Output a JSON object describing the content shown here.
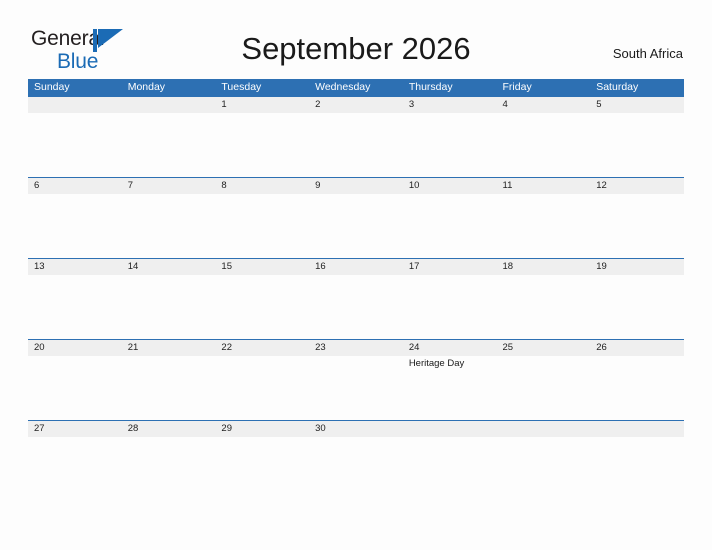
{
  "brand": {
    "name_part1": "General",
    "name_part2": "Blue",
    "flag_icon": "pennant-flag-icon",
    "accent_color": "#1b6bb5"
  },
  "header": {
    "title": "September 2026",
    "region": "South Africa"
  },
  "theme": {
    "header_blue": "#2d70b3",
    "band_gray": "#efefef",
    "page_background": "#fdfdfd",
    "text_dark": "#1a1a1a"
  },
  "calendar": {
    "month": "September",
    "year": "2026",
    "weekday_headers": [
      "Sunday",
      "Monday",
      "Tuesday",
      "Wednesday",
      "Thursday",
      "Friday",
      "Saturday"
    ],
    "weeks": [
      {
        "days": [
          {
            "num": "",
            "event": ""
          },
          {
            "num": "",
            "event": ""
          },
          {
            "num": "1",
            "event": ""
          },
          {
            "num": "2",
            "event": ""
          },
          {
            "num": "3",
            "event": ""
          },
          {
            "num": "4",
            "event": ""
          },
          {
            "num": "5",
            "event": ""
          }
        ]
      },
      {
        "days": [
          {
            "num": "6",
            "event": ""
          },
          {
            "num": "7",
            "event": ""
          },
          {
            "num": "8",
            "event": ""
          },
          {
            "num": "9",
            "event": ""
          },
          {
            "num": "10",
            "event": ""
          },
          {
            "num": "11",
            "event": ""
          },
          {
            "num": "12",
            "event": ""
          }
        ]
      },
      {
        "days": [
          {
            "num": "13",
            "event": ""
          },
          {
            "num": "14",
            "event": ""
          },
          {
            "num": "15",
            "event": ""
          },
          {
            "num": "16",
            "event": ""
          },
          {
            "num": "17",
            "event": ""
          },
          {
            "num": "18",
            "event": ""
          },
          {
            "num": "19",
            "event": ""
          }
        ]
      },
      {
        "days": [
          {
            "num": "20",
            "event": ""
          },
          {
            "num": "21",
            "event": ""
          },
          {
            "num": "22",
            "event": ""
          },
          {
            "num": "23",
            "event": ""
          },
          {
            "num": "24",
            "event": "Heritage Day"
          },
          {
            "num": "25",
            "event": ""
          },
          {
            "num": "26",
            "event": ""
          }
        ]
      },
      {
        "days": [
          {
            "num": "27",
            "event": ""
          },
          {
            "num": "28",
            "event": ""
          },
          {
            "num": "29",
            "event": ""
          },
          {
            "num": "30",
            "event": ""
          },
          {
            "num": "",
            "event": ""
          },
          {
            "num": "",
            "event": ""
          },
          {
            "num": "",
            "event": ""
          }
        ]
      }
    ]
  }
}
